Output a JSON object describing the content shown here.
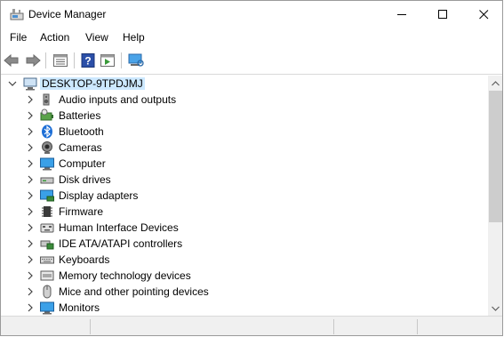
{
  "window": {
    "title": "Device Manager"
  },
  "menu": [
    "File",
    "Action",
    "View",
    "Help"
  ],
  "toolbar": {
    "buttons": [
      "back-arrow-icon",
      "forward-arrow-icon",
      "properties-icon",
      "help-icon",
      "run-icon",
      "scan-hardware-icon"
    ]
  },
  "tree": {
    "root": {
      "label": "DESKTOP-9TPDJMJ",
      "icon": "computer-icon"
    },
    "items": [
      {
        "label": "Audio inputs and outputs",
        "icon": "speaker-icon"
      },
      {
        "label": "Batteries",
        "icon": "battery-icon"
      },
      {
        "label": "Bluetooth",
        "icon": "bluetooth-icon"
      },
      {
        "label": "Cameras",
        "icon": "camera-icon"
      },
      {
        "label": "Computer",
        "icon": "monitor-icon"
      },
      {
        "label": "Disk drives",
        "icon": "disk-drive-icon"
      },
      {
        "label": "Display adapters",
        "icon": "display-adapter-icon"
      },
      {
        "label": "Firmware",
        "icon": "chip-icon"
      },
      {
        "label": "Human Interface Devices",
        "icon": "hid-icon"
      },
      {
        "label": "IDE ATA/ATAPI controllers",
        "icon": "ide-controller-icon"
      },
      {
        "label": "Keyboards",
        "icon": "keyboard-icon"
      },
      {
        "label": "Memory technology devices",
        "icon": "memory-icon"
      },
      {
        "label": "Mice and other pointing devices",
        "icon": "mouse-icon"
      },
      {
        "label": "Monitors",
        "icon": "monitor-icon"
      }
    ]
  },
  "colors": {
    "selection": "#cce8ff",
    "accent": "#0078d7"
  }
}
